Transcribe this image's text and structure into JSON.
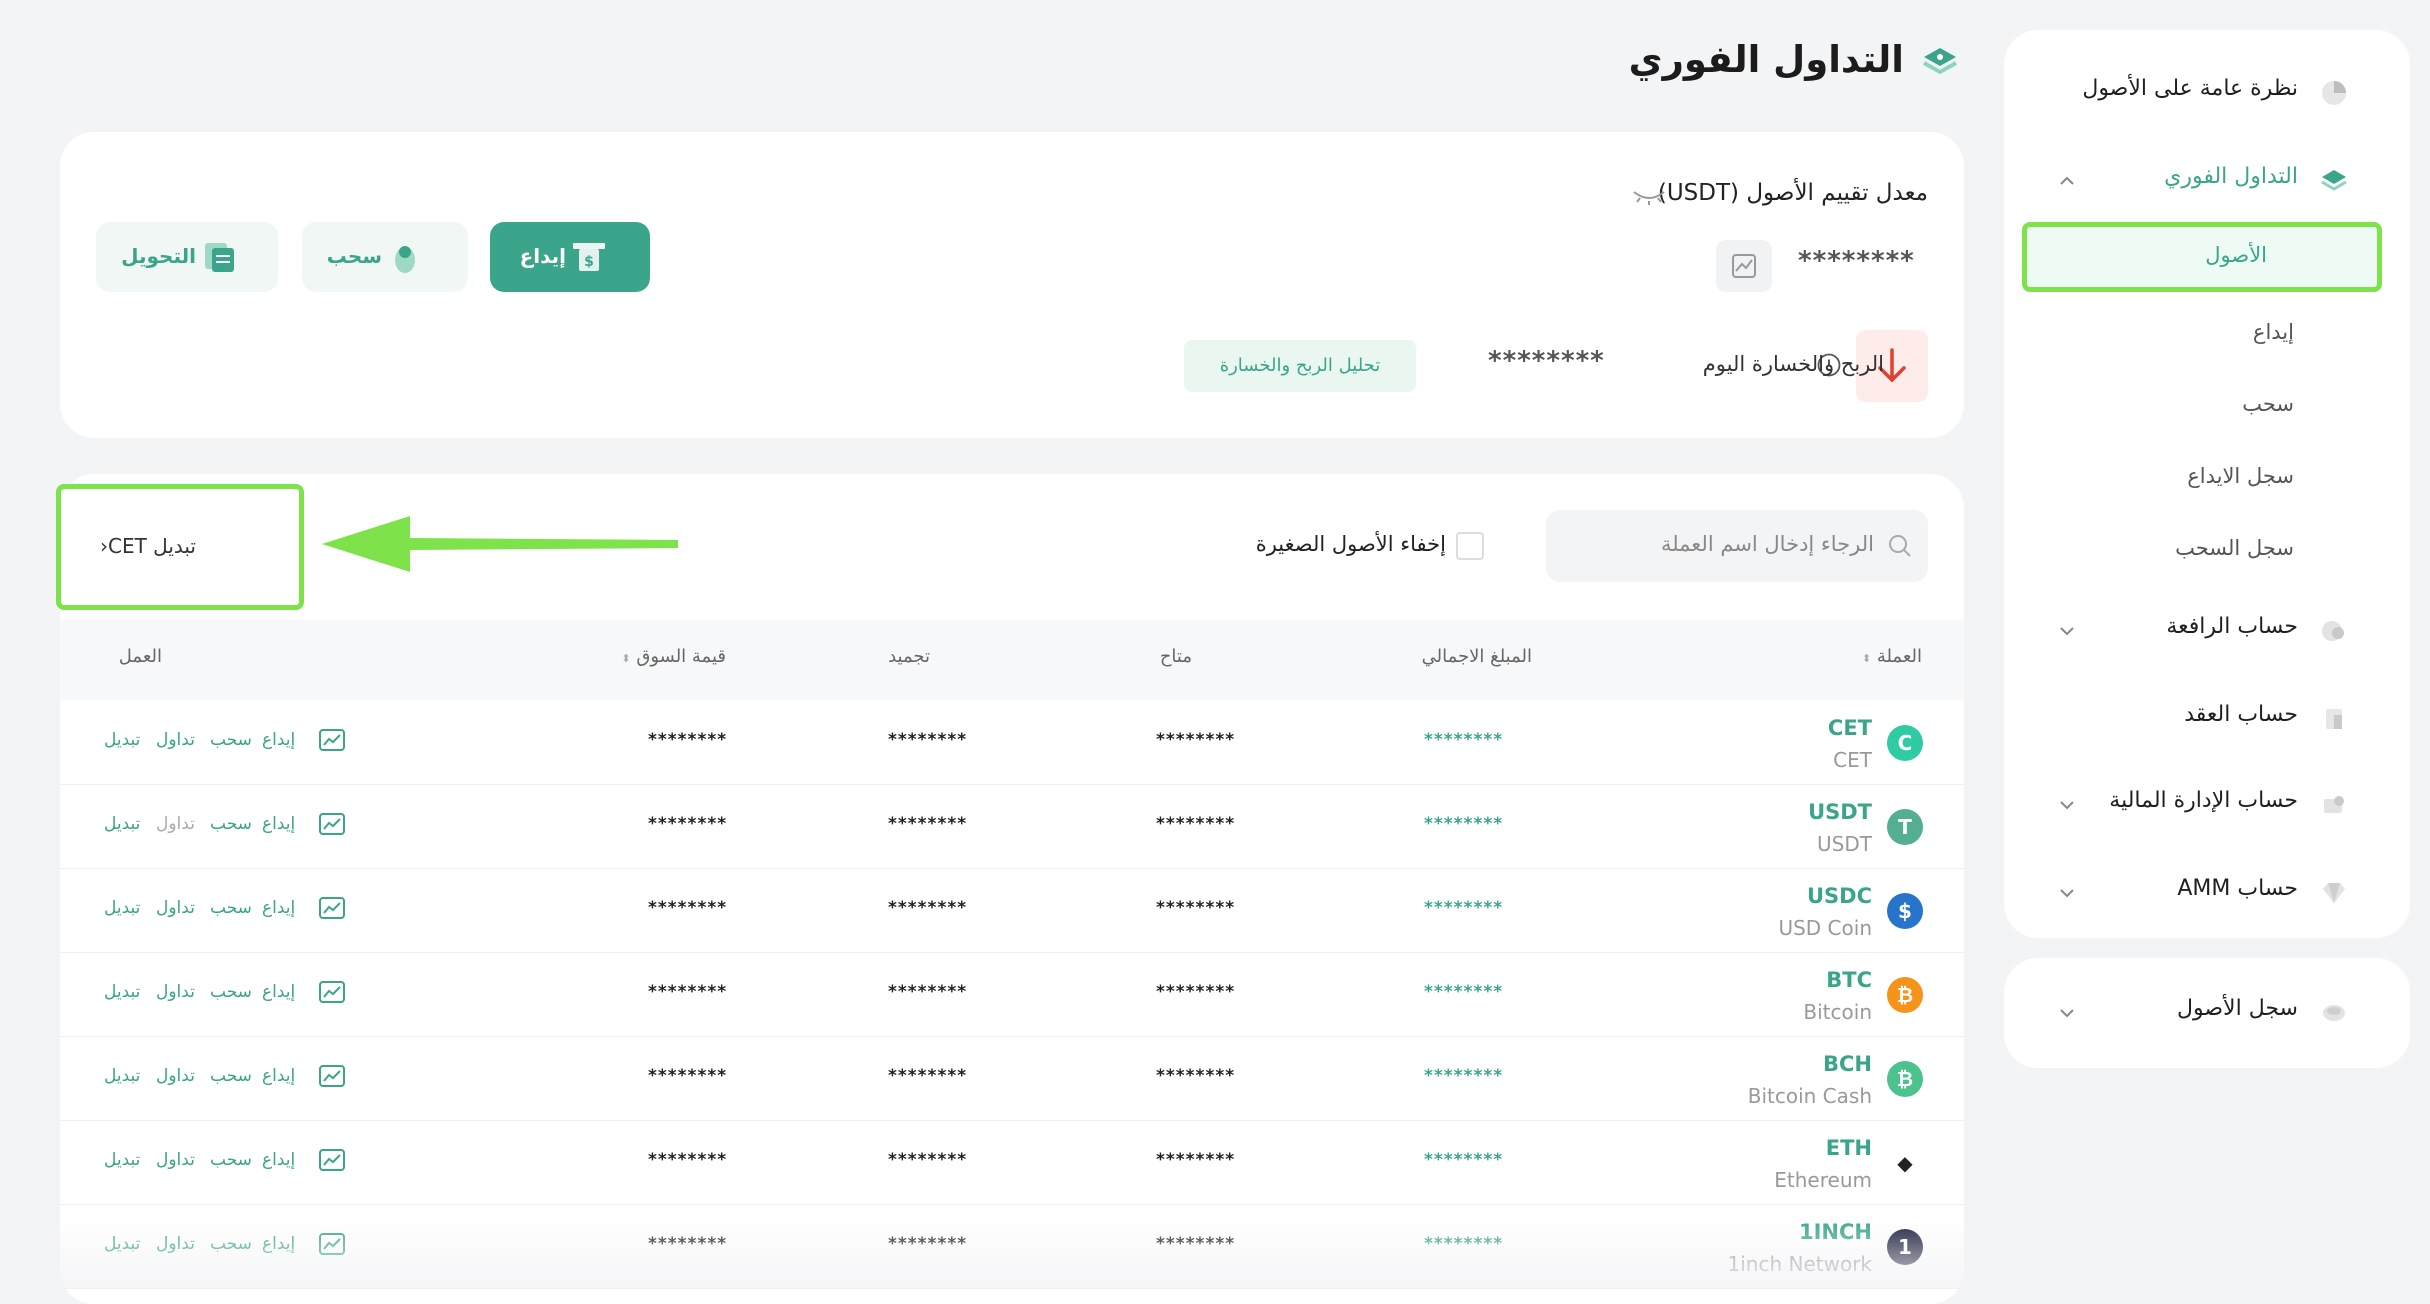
{
  "sidebar": {
    "items": [
      {
        "label": "نظرة عامة على الأصول",
        "icon": "pie-chart-icon"
      },
      {
        "label": "التداول الفوري",
        "icon": "layers-icon",
        "expanded": true
      },
      {
        "label": "حساب الرافعة",
        "icon": "leverage-icon"
      },
      {
        "label": "حساب العقد",
        "icon": "contract-icon"
      },
      {
        "label": "حساب الإدارة المالية",
        "icon": "finance-icon"
      },
      {
        "label": "حساب AMM",
        "icon": "amm-icon"
      }
    ],
    "sub_items": [
      {
        "label": "الأصول",
        "active": true
      },
      {
        "label": "إيداع"
      },
      {
        "label": "سحب"
      },
      {
        "label": "سجل الايداع"
      },
      {
        "label": "سجل السحب"
      }
    ],
    "history": {
      "label": "سجل الأصول",
      "icon": "history-icon"
    }
  },
  "page_title": "التداول الفوري",
  "overview": {
    "valuation_label": "معدل تقييم الأصول (USDT)",
    "balance": "********",
    "pnl_label": "الربح والخسارة اليوم",
    "pnl_value": "********",
    "pnl_button": "تحليل الربح والخسارة",
    "buttons": {
      "deposit": "إيداع",
      "withdraw": "سحب",
      "transfer": "التحويل"
    }
  },
  "assets": {
    "search_placeholder": "الرجاء إدخال اسم العملة",
    "hide_small_label": "إخفاء الأصول الصغيرة",
    "convert_cet": "تبديل CET",
    "convert_cet_chevron": "‹",
    "columns": {
      "coin": "العملة",
      "total": "المبلغ الاجمالي",
      "available": "متاح",
      "frozen": "تجميد",
      "market_value": "قيمة السوق",
      "actions": "العمل"
    },
    "action_labels": {
      "deposit": "إيداع",
      "withdraw": "سحب",
      "trade": "تداول",
      "convert": "تبديل"
    },
    "accent_color": "#3aa58a",
    "rows": [
      {
        "symbol": "CET",
        "name": "CET",
        "total": "********",
        "available": "********",
        "frozen": "********",
        "market_value": "********",
        "icon_color": "#2fcca4",
        "icon_char": "C",
        "trade_enabled": true
      },
      {
        "symbol": "USDT",
        "name": "USDT",
        "total": "********",
        "available": "********",
        "frozen": "********",
        "market_value": "********",
        "icon_color": "#53ae94",
        "icon_char": "T",
        "trade_enabled": false
      },
      {
        "symbol": "USDC",
        "name": "USD Coin",
        "total": "********",
        "available": "********",
        "frozen": "********",
        "market_value": "********",
        "icon_color": "#2775ca",
        "icon_char": "$",
        "trade_enabled": true
      },
      {
        "symbol": "BTC",
        "name": "Bitcoin",
        "total": "********",
        "available": "********",
        "frozen": "********",
        "market_value": "********",
        "icon_color": "#f7931a",
        "icon_char": "₿",
        "trade_enabled": true
      },
      {
        "symbol": "BCH",
        "name": "Bitcoin Cash",
        "total": "********",
        "available": "********",
        "frozen": "********",
        "market_value": "********",
        "icon_color": "#4cc28f",
        "icon_char": "₿",
        "trade_enabled": true
      },
      {
        "symbol": "ETH",
        "name": "Ethereum",
        "total": "********",
        "available": "********",
        "frozen": "********",
        "market_value": "********",
        "icon_color": "#ffffff",
        "icon_char": "◆",
        "trade_enabled": true
      },
      {
        "symbol": "1INCH",
        "name": "1inch Network",
        "total": "********",
        "available": "********",
        "frozen": "********",
        "market_value": "********",
        "icon_color": "#1b1e3b",
        "icon_char": "1",
        "trade_enabled": true
      }
    ]
  }
}
